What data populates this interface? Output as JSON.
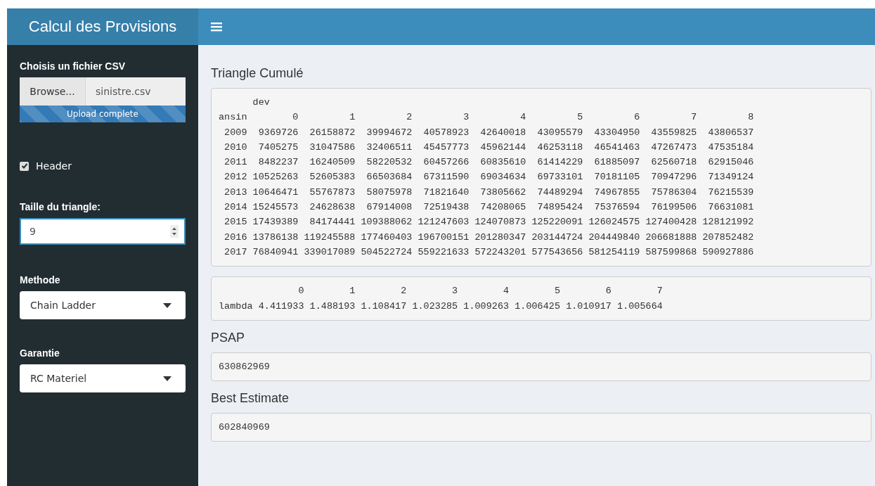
{
  "header": {
    "title": "Calcul des Provisions"
  },
  "sidebar": {
    "file_input": {
      "label": "Choisis un fichier CSV",
      "button": "Browse...",
      "filename": "sinistre.csv",
      "progress": "Upload complete",
      "level": 1
    },
    "header_checkbox": {
      "label": "Header",
      "checked": true
    },
    "triangle_size": {
      "label": "Taille du triangle:",
      "value": "9"
    },
    "method": {
      "label": "Methode",
      "value": "Chain Ladder"
    },
    "guarantee": {
      "label": "Garantie",
      "value": "RC Materiel"
    }
  },
  "main": {
    "triangle": {
      "title": "Triangle Cumulé",
      "axis_label": "dev",
      "row_label": "ansin",
      "columns": [
        "0",
        "1",
        "2",
        "3",
        "4",
        "5",
        "6",
        "7",
        "8"
      ],
      "rows": [
        {
          "label": "2009",
          "cells": [
            "9369726",
            "26158872",
            "39994672",
            "40578923",
            "42640018",
            "43095579",
            "43304950",
            "43559825",
            "43806537"
          ]
        },
        {
          "label": "2010",
          "cells": [
            "7405275",
            "31047586",
            "32406511",
            "45457773",
            "45962144",
            "46253118",
            "46541463",
            "47267473",
            "47535184"
          ]
        },
        {
          "label": "2011",
          "cells": [
            "8482237",
            "16240509",
            "58220532",
            "60457266",
            "60835610",
            "61414229",
            "61885097",
            "62560718",
            "62915046"
          ]
        },
        {
          "label": "2012",
          "cells": [
            "10525263",
            "52605383",
            "66503684",
            "67311590",
            "69034634",
            "69733101",
            "70181105",
            "70947296",
            "71349124"
          ]
        },
        {
          "label": "2013",
          "cells": [
            "10646471",
            "55767873",
            "58075978",
            "71821640",
            "73805662",
            "74489294",
            "74967855",
            "75786304",
            "76215539"
          ]
        },
        {
          "label": "2014",
          "cells": [
            "15245573",
            "24628638",
            "67914008",
            "72519438",
            "74208065",
            "74895424",
            "75376594",
            "76199506",
            "76631081"
          ]
        },
        {
          "label": "2015",
          "cells": [
            "17439389",
            "84174441",
            "109388062",
            "121247603",
            "124070873",
            "125220091",
            "126024575",
            "127400428",
            "128121992"
          ]
        },
        {
          "label": "2016",
          "cells": [
            "13786138",
            "119245588",
            "177460403",
            "196700151",
            "201280347",
            "203144724",
            "204449840",
            "206681888",
            "207852482"
          ]
        },
        {
          "label": "2017",
          "cells": [
            "76840941",
            "339017089",
            "504522724",
            "559221633",
            "572243201",
            "577543656",
            "581254119",
            "587599868",
            "590927886"
          ]
        }
      ]
    },
    "lambda": {
      "columns": [
        "0",
        "1",
        "2",
        "3",
        "4",
        "5",
        "6",
        "7"
      ],
      "rows": [
        {
          "label": "lambda",
          "cells": [
            "4.411933",
            "1.488193",
            "1.108417",
            "1.023285",
            "1.009263",
            "1.006425",
            "1.010917",
            "1.005664"
          ]
        }
      ]
    },
    "psap": {
      "title": "PSAP",
      "value": "630862969"
    },
    "best_estimate": {
      "title": "Best Estimate",
      "value": "602840969"
    }
  }
}
